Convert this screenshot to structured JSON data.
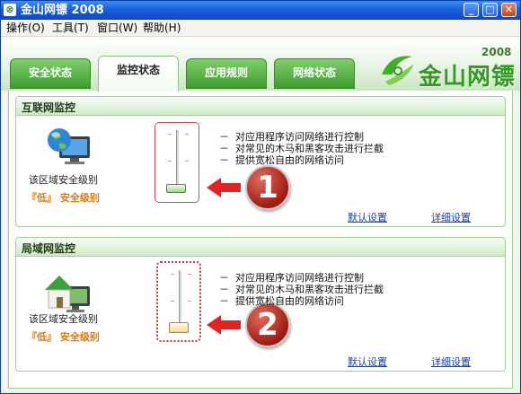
{
  "window": {
    "title": "金山网镖 2008",
    "app_icon_glyph": "⊗",
    "buttons": {
      "minimize": "_",
      "maximize": "□",
      "close": "✕"
    }
  },
  "menu": [
    {
      "label": "操作(O)"
    },
    {
      "label": "工具(T)"
    },
    {
      "label": "窗口(W)"
    },
    {
      "label": "帮助(H)"
    }
  ],
  "tabs": [
    {
      "label": "安全状态",
      "active": false
    },
    {
      "label": "监控状态",
      "active": true
    },
    {
      "label": "应用规则",
      "active": false
    },
    {
      "label": "网络状态",
      "active": false
    }
  ],
  "logo": {
    "text": "金山网镖",
    "version": "2008"
  },
  "panels": [
    {
      "title": "互联网监控",
      "zone_label": "该区域安全级别",
      "level": "『低』 安全级别",
      "bullets": [
        "对应用程序访问网络进行控制",
        "对常见的木马和黑客攻击进行拦截",
        "提供宽松自由的网络访问"
      ],
      "badge": "1",
      "default_link": "默认设置",
      "detail_link": "详细设置",
      "icon": "globe-monitor-icon",
      "slider_level": 0
    },
    {
      "title": "局域网监控",
      "zone_label": "该区域安全级别",
      "level": "『低』 安全级别",
      "bullets": [
        "对应用程序访问网络进行控制",
        "对常见的木马和黑客攻击进行拦截",
        "提供宽松自由的网络访问"
      ],
      "badge": "2",
      "default_link": "默认设置",
      "detail_link": "详细设置",
      "icon": "house-monitor-icon",
      "slider_level": 0
    }
  ],
  "colors": {
    "accent_green": "#3e9d2f",
    "level_orange": "#e07a10",
    "link_blue": "#1b3fa5",
    "marker_red": "#9e1b12"
  }
}
